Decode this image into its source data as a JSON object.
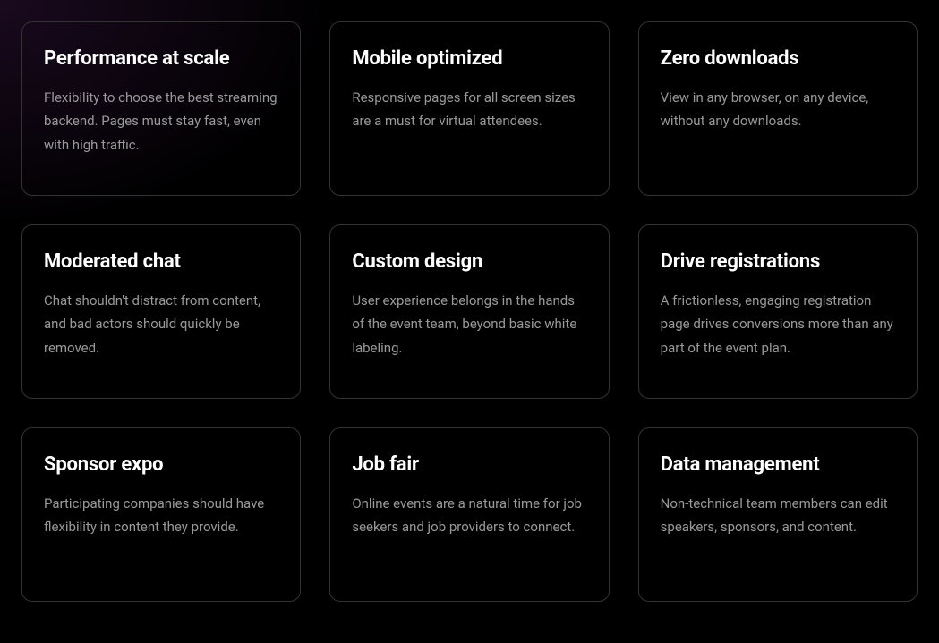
{
  "cards": [
    {
      "title": "Performance at scale",
      "desc": "Flexibility to choose the best streaming backend. Pages must stay fast, even with high traffic."
    },
    {
      "title": "Mobile optimized",
      "desc": "Responsive pages for all screen sizes are a must for virtual attendees."
    },
    {
      "title": "Zero downloads",
      "desc": "View in any browser, on any device, without any downloads."
    },
    {
      "title": "Moderated chat",
      "desc": "Chat shouldn't distract from content, and bad actors should quickly be removed."
    },
    {
      "title": "Custom design",
      "desc": "User experience belongs in the hands of the event team, beyond basic white labeling."
    },
    {
      "title": "Drive registrations",
      "desc": "A frictionless, engaging registration page drives conversions more than any part of the event plan."
    },
    {
      "title": "Sponsor expo",
      "desc": "Participating companies should have flexibility in content they provide."
    },
    {
      "title": "Job fair",
      "desc": "Online events are a natural time for job seekers and job providers to connect."
    },
    {
      "title": "Data management",
      "desc": "Non-technical team members can edit speakers, sponsors, and content."
    }
  ]
}
